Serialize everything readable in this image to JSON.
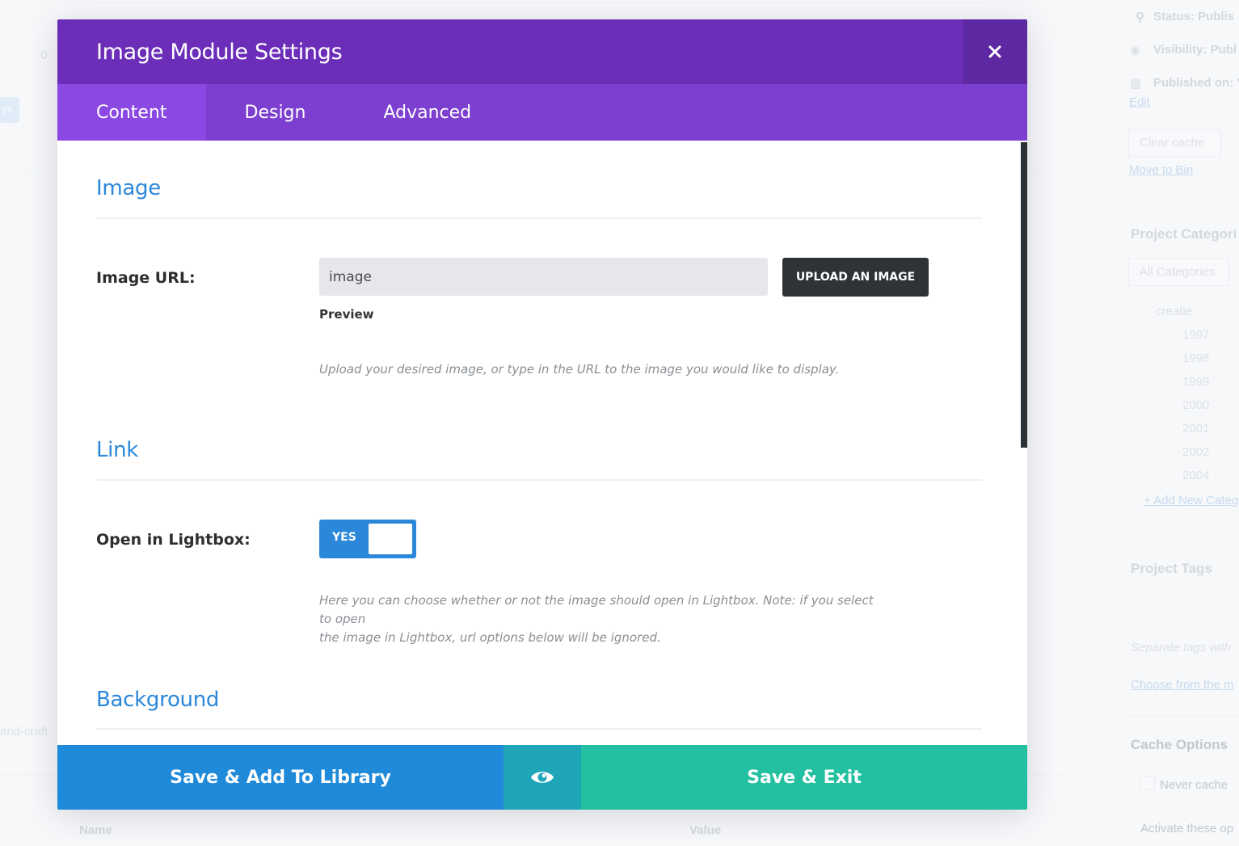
{
  "modal": {
    "title": "Image Module Settings",
    "close_icon": "close-icon",
    "tabs": [
      {
        "label": "Content",
        "active": true
      },
      {
        "label": "Design",
        "active": false
      },
      {
        "label": "Advanced",
        "active": false
      }
    ]
  },
  "sections": {
    "image": {
      "title": "Image",
      "url_label": "Image URL:",
      "url_value": "image",
      "upload_button": "UPLOAD AN IMAGE",
      "preview_label": "Preview",
      "help": "Upload your desired image, or type in the URL to the image you would like to display."
    },
    "link": {
      "title": "Link",
      "lightbox_label": "Open in Lightbox:",
      "toggle_value": "YES",
      "help_line1": "Here you can choose whether or not the image should open in Lightbox. Note: if you select to open",
      "help_line2": "the image in Lightbox, url options below will be ignored."
    },
    "background": {
      "title": "Background"
    }
  },
  "footer": {
    "save_library": "Save & Add To Library",
    "preview_icon": "eye-icon",
    "save_exit": "Save & Exit"
  },
  "background_page": {
    "status": "Status: Publis",
    "visibility": "Visibility: Publ",
    "published": "Published on: '",
    "edit": "Edit",
    "clear_cache": "Clear cache",
    "move_to_bin": "Move to Bin",
    "project_categories": "Project Categori",
    "all_categories": "All Categories",
    "creatie": "creatie",
    "years": [
      "1997",
      "1998",
      "1999",
      "2000",
      "2001",
      "2002",
      "2004"
    ],
    "add_new_category": "+ Add New Categ",
    "project_tags": "Project Tags",
    "separate_tags": "Separate tags with",
    "choose_from": "Choose from the m",
    "cache_options": "Cache Options",
    "never_cache": "Never cache",
    "activate": "Activate these op",
    "left_zero": "0",
    "left_chip": "ys",
    "left_craft": "and-craft",
    "col_name": "Name",
    "col_value": "Value"
  },
  "colors": {
    "header": "#6c2eb9",
    "tabs": "#7d3fcf",
    "active_tab": "#8b48e3",
    "accent_blue": "#2b87da",
    "save_library": "#1f8ad9",
    "preview": "#1fa5b8",
    "save_exit": "#22c0a0"
  }
}
